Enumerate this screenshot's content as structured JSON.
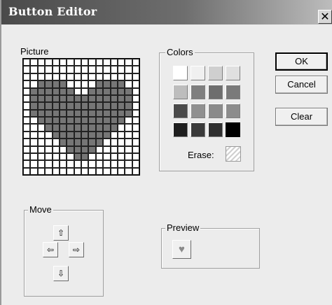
{
  "window": {
    "title": "Button Editor",
    "close_glyph": "✕"
  },
  "picture": {
    "label": "Picture",
    "grid_size": 16,
    "fill_color": "#767676",
    "pattern": [
      "0000000000000000",
      "0000000000000000",
      "0000000000000000",
      "0011110000111100",
      "0111111001111110",
      "0111111111111110",
      "0111111111111110",
      "0111111111111110",
      "0011111111111100",
      "0001111111111000",
      "0000111111110000",
      "0000011111100000",
      "0000001111000000",
      "0000000110000000",
      "0000000000000000",
      "0000000000000000"
    ]
  },
  "colors": {
    "label": "Colors",
    "swatches": [
      "#ffffff",
      "#f0f0f0",
      "#cfcfcf",
      "#e0e0e0",
      "#bdbdbd",
      "#7f7f7f",
      "#6e6e6e",
      "#7a7a7a",
      "#4a4a4a",
      "#909090",
      "#8a8a8a",
      "#8c8c8c",
      "#1e1e1e",
      "#3a3a3a",
      "#303030",
      "#000000"
    ],
    "selected_index": 15,
    "erase_label": "Erase:"
  },
  "buttons": {
    "ok": "OK",
    "cancel": "Cancel",
    "clear": "Clear"
  },
  "move": {
    "label": "Move",
    "up": "⇧",
    "left": "⇦",
    "right": "⇨",
    "down": "⇩"
  },
  "preview": {
    "label": "Preview",
    "icon_color": "#8a8a8a"
  }
}
